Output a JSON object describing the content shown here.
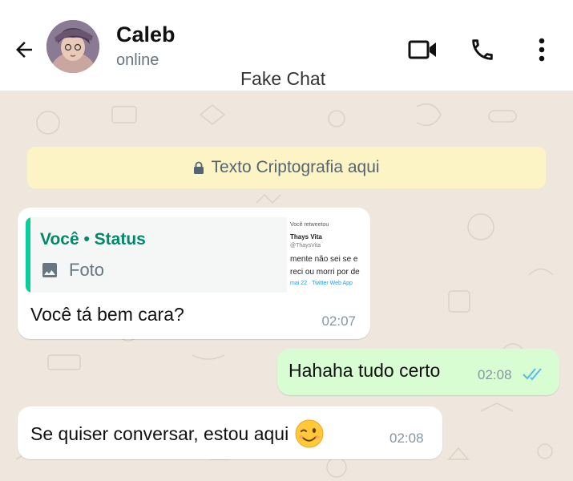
{
  "header": {
    "contact_name": "Caleb",
    "contact_status": "online",
    "chat_title": "Fake Chat",
    "icons": [
      "back-arrow-icon",
      "video-call-icon",
      "voice-call-icon",
      "more-vert-icon"
    ]
  },
  "encryption_banner": {
    "text": "Texto Criptografia aqui",
    "icon": "lock-icon"
  },
  "messages": [
    {
      "direction": "incoming",
      "reply": {
        "author": "Você • Status",
        "type_label": "Foto",
        "thumbnail_lines": [
          "Você retweetou",
          "Thays Vita",
          "@ThaysVita",
          "mente não sei se e",
          "reci ou morri por de",
          "mai 22 · Twitter Web App"
        ]
      },
      "text": "Você tá bem cara?",
      "time": "02:07"
    },
    {
      "direction": "outgoing",
      "text": "Hahaha tudo certo",
      "time": "02:08",
      "status": "read"
    },
    {
      "direction": "incoming",
      "text": "Se quiser conversar, estou aqui",
      "emoji": "winking-face",
      "time": "02:08"
    }
  ],
  "colors": {
    "chat_background": "#efe7dd",
    "banner_background": "#fdf4c5",
    "outgoing_bubble": "#d9fdd3",
    "reply_accent": "#06cf9c",
    "read_ticks": "#53bdeb"
  }
}
